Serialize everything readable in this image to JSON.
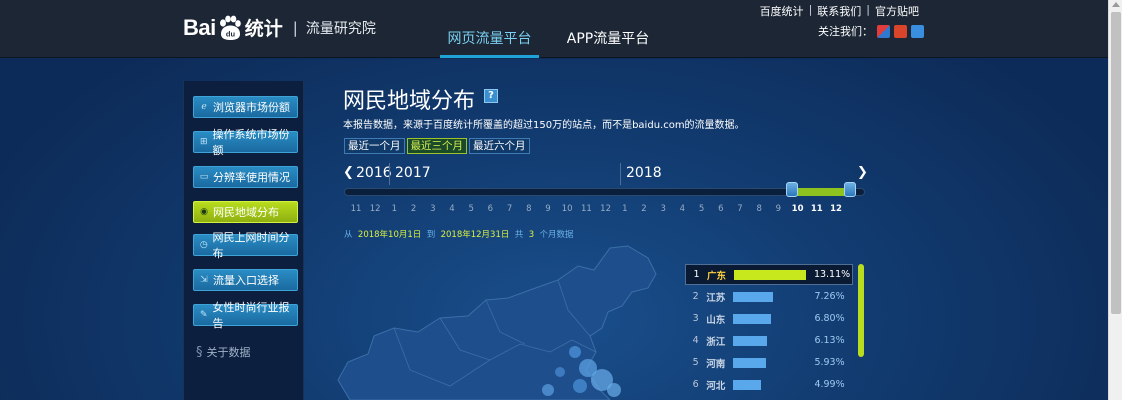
{
  "header": {
    "logo_bai": "Bai",
    "logo_du": "du",
    "logo_tongji": "统计",
    "logo_sep": "|",
    "logo_sub": "流量研究院",
    "tabs": [
      {
        "label": "网页流量平台"
      },
      {
        "label": "APP流量平台"
      }
    ],
    "toplinks": [
      "百度统计",
      "联系我们",
      "官方贴吧"
    ],
    "toplinks_sep": "|",
    "follow_label": "关注我们："
  },
  "sidebar": {
    "items": [
      {
        "label": "浏览器市场份额",
        "icon": "browser-icon"
      },
      {
        "label": "操作系统市场份额",
        "icon": "os-icon"
      },
      {
        "label": "分辨率使用情况",
        "icon": "monitor-icon"
      },
      {
        "label": "网民地域分布",
        "icon": "globe-icon"
      },
      {
        "label": "网民上网时间分布",
        "icon": "clock-icon"
      },
      {
        "label": "流量入口选择",
        "icon": "entry-icon"
      },
      {
        "label": "女性时尚行业报告",
        "icon": "report-icon"
      }
    ],
    "about_label": "关于数据"
  },
  "content": {
    "title": "网民地域分布",
    "help_glyph": "?",
    "description": "本报告数据，来源于百度统计所覆盖的超过150万的站点，而不是baidu.com的流量数据。",
    "range_buttons": [
      "最近一个月",
      "最近三个月",
      "最近六个月"
    ],
    "timeline": {
      "prev_arrow": "❮",
      "next_arrow": "❯",
      "years": [
        "2016",
        "2017",
        "2018"
      ],
      "months": [
        "11",
        "12",
        "1",
        "2",
        "3",
        "4",
        "5",
        "6",
        "7",
        "8",
        "9",
        "10",
        "11",
        "12",
        "1",
        "2",
        "3",
        "4",
        "5",
        "6",
        "7",
        "8",
        "9",
        "10",
        "11",
        "12"
      ]
    },
    "period": {
      "from_label": "从",
      "start": "2018年10月1日",
      "to_label": "到",
      "end": "2018年12月31日",
      "total_label": "共",
      "count": "3",
      "unit": "个月数据"
    },
    "ranking": [
      {
        "rank": "1",
        "name": "广东",
        "value": "13.11%",
        "pct": 13.11
      },
      {
        "rank": "2",
        "name": "江苏",
        "value": "7.26%",
        "pct": 7.26
      },
      {
        "rank": "3",
        "name": "山东",
        "value": "6.80%",
        "pct": 6.8
      },
      {
        "rank": "4",
        "name": "浙江",
        "value": "6.13%",
        "pct": 6.13
      },
      {
        "rank": "5",
        "name": "河南",
        "value": "5.93%",
        "pct": 5.93
      },
      {
        "rank": "6",
        "name": "河北",
        "value": "4.99%",
        "pct": 4.99
      }
    ]
  },
  "colors": {
    "accent_blue": "#1fa3d6",
    "accent_green": "#b8dc1e",
    "bar_blue": "#5aa8ec",
    "bg_dark": "#0e2c5a"
  }
}
